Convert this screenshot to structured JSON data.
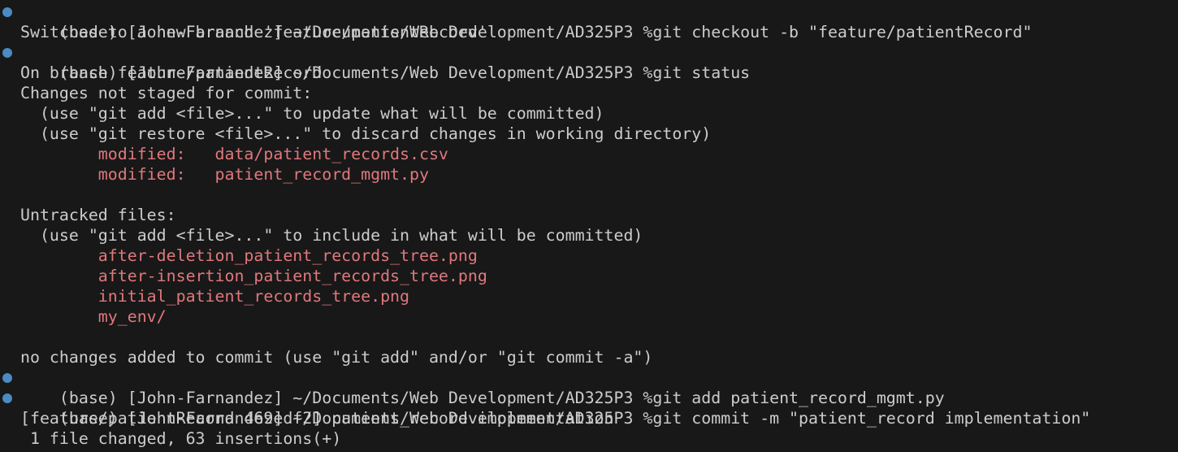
{
  "colors": {
    "background": "#181818",
    "foreground": "#cccccc",
    "marker": "#4b8ac3",
    "changed": "#e0787d"
  },
  "lines": {
    "l1": "(base) [John-Farnandez] ~/Documents/Web Development/AD325P3 %git checkout -b \"feature/patientRecord\"",
    "l2": "Switched to a new branch 'feature/patientRecord'",
    "l3": "(base) [John-Farnandez] ~/Documents/Web Development/AD325P3 %git status",
    "l4": "On branch feature/patientRecord",
    "l5": "Changes not staged for commit:",
    "l6": "  (use \"git add <file>...\" to update what will be committed)",
    "l7": "  (use \"git restore <file>...\" to discard changes in working directory)",
    "l8": "        modified:   data/patient_records.csv",
    "l9": "        modified:   patient_record_mgmt.py",
    "l10": "",
    "l11": "Untracked files:",
    "l12": "  (use \"git add <file>...\" to include in what will be committed)",
    "l13": "        after-deletion_patient_records_tree.png",
    "l14": "        after-insertion_patient_records_tree.png",
    "l15": "        initial_patient_records_tree.png",
    "l16": "        my_env/",
    "l17": "",
    "l18": "no changes added to commit (use \"git add\" and/or \"git commit -a\")",
    "l19": "(base) [John-Farnandez] ~/Documents/Web Development/AD325P3 %git add patient_record_mgmt.py",
    "l20": "(base) [John-Farnandez] ~/Documents/Web Development/AD325P3 %git commit -m \"patient_record implementation\"",
    "l21": "[feature/patientRecord 469edf2] patient_record implementation",
    "l22": " 1 file changed, 63 insertions(+)"
  }
}
